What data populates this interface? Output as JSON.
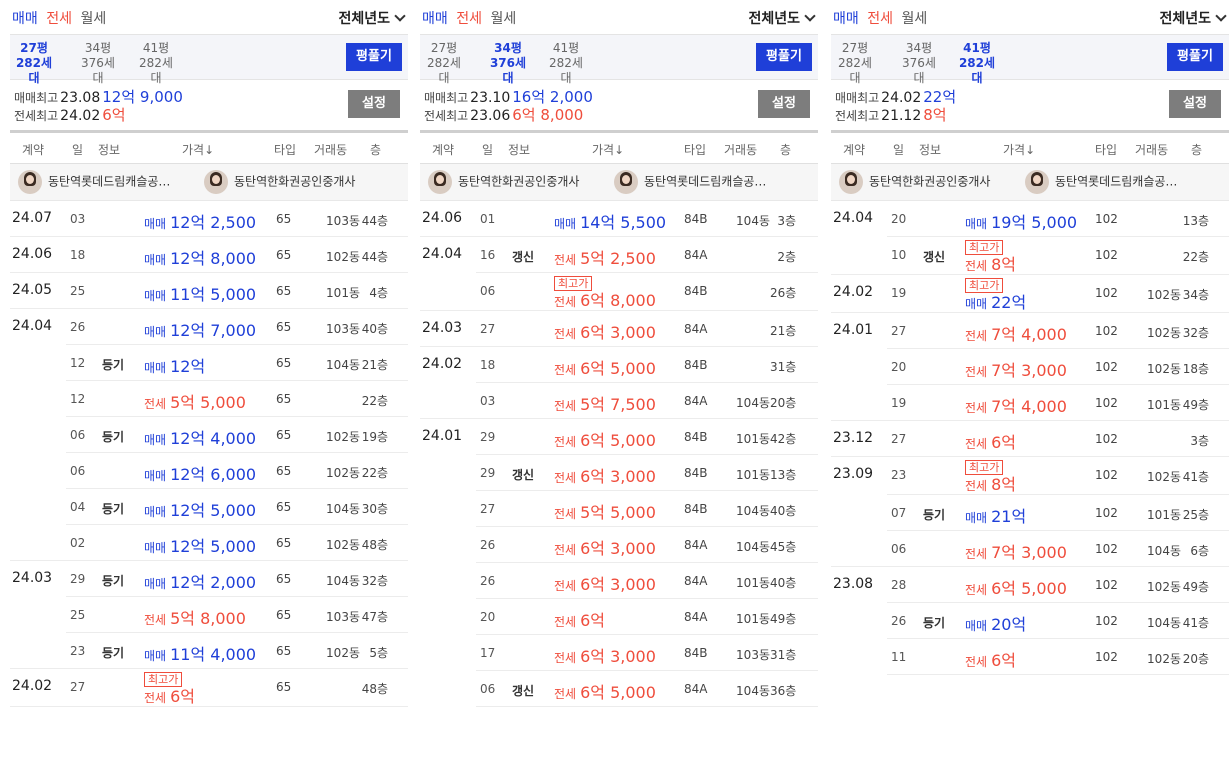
{
  "panels": [
    {
      "tabs": {
        "sale": "매매",
        "jeonse": "전세",
        "rent": "월세"
      },
      "year_filter": "전체년도",
      "sizes": [
        {
          "pyeong": "27평",
          "households": "282세대"
        },
        {
          "pyeong": "34평",
          "households": "376세대"
        },
        {
          "pyeong": "41평",
          "households": "282세대"
        }
      ],
      "pyeong_button": "평풀기",
      "max_sale": {
        "label": "매매최고",
        "date": "23.08",
        "price": "12억 9,000"
      },
      "max_jeonse": {
        "label": "전세최고",
        "date": "24.02",
        "price": "6억"
      },
      "settings_button": "설정",
      "headers": {
        "contract": "계약",
        "day": "일",
        "info": "정보",
        "price": "가격↓",
        "type": "타입",
        "dong": "거래동",
        "floor": "층"
      },
      "agents": [
        "동탄역롯데드림캐슬공…",
        "동탄역한화권공인중개사"
      ],
      "rows": [
        {
          "ym": "24.07",
          "day": "03",
          "info": "",
          "badge": "",
          "kind": "매매",
          "price": "12억 2,500",
          "type": "65",
          "dong": "103동",
          "floor": "44층"
        },
        {
          "ym": "24.06",
          "day": "18",
          "info": "",
          "badge": "",
          "kind": "매매",
          "price": "12억 8,000",
          "type": "65",
          "dong": "102동",
          "floor": "44층"
        },
        {
          "ym": "24.05",
          "day": "25",
          "info": "",
          "badge": "",
          "kind": "매매",
          "price": "11억 5,000",
          "type": "65",
          "dong": "101동",
          "floor": "4층"
        },
        {
          "ym": "24.04",
          "day": "26",
          "info": "",
          "badge": "",
          "kind": "매매",
          "price": "12억 7,000",
          "type": "65",
          "dong": "103동",
          "floor": "40층"
        },
        {
          "ym": "",
          "day": "12",
          "info": "등기",
          "badge": "",
          "kind": "매매",
          "price": "12억",
          "type": "65",
          "dong": "104동",
          "floor": "21층"
        },
        {
          "ym": "",
          "day": "12",
          "info": "",
          "badge": "",
          "kind": "전세",
          "price": "5억 5,000",
          "type": "65",
          "dong": "",
          "floor": "22층"
        },
        {
          "ym": "",
          "day": "06",
          "info": "등기",
          "badge": "",
          "kind": "매매",
          "price": "12억 4,000",
          "type": "65",
          "dong": "102동",
          "floor": "19층"
        },
        {
          "ym": "",
          "day": "06",
          "info": "",
          "badge": "",
          "kind": "매매",
          "price": "12억 6,000",
          "type": "65",
          "dong": "102동",
          "floor": "22층"
        },
        {
          "ym": "",
          "day": "04",
          "info": "등기",
          "badge": "",
          "kind": "매매",
          "price": "12억 5,000",
          "type": "65",
          "dong": "104동",
          "floor": "30층"
        },
        {
          "ym": "",
          "day": "02",
          "info": "",
          "badge": "",
          "kind": "매매",
          "price": "12억 5,000",
          "type": "65",
          "dong": "102동",
          "floor": "48층"
        },
        {
          "ym": "24.03",
          "day": "29",
          "info": "등기",
          "badge": "",
          "kind": "매매",
          "price": "12억 2,000",
          "type": "65",
          "dong": "104동",
          "floor": "32층"
        },
        {
          "ym": "",
          "day": "25",
          "info": "",
          "badge": "",
          "kind": "전세",
          "price": "5억 8,000",
          "type": "65",
          "dong": "103동",
          "floor": "47층"
        },
        {
          "ym": "",
          "day": "23",
          "info": "등기",
          "badge": "",
          "kind": "매매",
          "price": "11억 4,000",
          "type": "65",
          "dong": "102동",
          "floor": "5층"
        },
        {
          "ym": "24.02",
          "day": "27",
          "info": "",
          "badge": "최고가",
          "kind": "전세",
          "price": "6억",
          "type": "65",
          "dong": "",
          "floor": "48층"
        }
      ]
    },
    {
      "tabs": {
        "sale": "매매",
        "jeonse": "전세",
        "rent": "월세"
      },
      "year_filter": "전체년도",
      "sizes": [
        {
          "pyeong": "27평",
          "households": "282세대"
        },
        {
          "pyeong": "34평",
          "households": "376세대"
        },
        {
          "pyeong": "41평",
          "households": "282세대"
        }
      ],
      "pyeong_button": "평풀기",
      "max_sale": {
        "label": "매매최고",
        "date": "23.10",
        "price": "16억 2,000"
      },
      "max_jeonse": {
        "label": "전세최고",
        "date": "23.06",
        "price": "6억 8,000"
      },
      "settings_button": "설정",
      "headers": {
        "contract": "계약",
        "day": "일",
        "info": "정보",
        "price": "가격↓",
        "type": "타입",
        "dong": "거래동",
        "floor": "층"
      },
      "agents": [
        "동탄역한화권공인중개사",
        "동탄역롯데드림캐슬공…"
      ],
      "rows": [
        {
          "ym": "24.06",
          "day": "01",
          "info": "",
          "badge": "",
          "kind": "매매",
          "price": "14억 5,500",
          "type": "84B",
          "dong": "104동",
          "floor": "3층"
        },
        {
          "ym": "24.04",
          "day": "16",
          "info": "갱신",
          "badge": "",
          "kind": "전세",
          "price": "5억 2,500",
          "type": "84A",
          "dong": "",
          "floor": "2층"
        },
        {
          "ym": "",
          "day": "06",
          "info": "",
          "badge": "최고가",
          "kind": "전세",
          "price": "6억 8,000",
          "type": "84B",
          "dong": "",
          "floor": "26층"
        },
        {
          "ym": "24.03",
          "day": "27",
          "info": "",
          "badge": "",
          "kind": "전세",
          "price": "6억 3,000",
          "type": "84A",
          "dong": "",
          "floor": "21층"
        },
        {
          "ym": "24.02",
          "day": "18",
          "info": "",
          "badge": "",
          "kind": "전세",
          "price": "6억 5,000",
          "type": "84B",
          "dong": "",
          "floor": "31층"
        },
        {
          "ym": "",
          "day": "03",
          "info": "",
          "badge": "",
          "kind": "전세",
          "price": "5억 7,500",
          "type": "84A",
          "dong": "104동",
          "floor": "20층"
        },
        {
          "ym": "24.01",
          "day": "29",
          "info": "",
          "badge": "",
          "kind": "전세",
          "price": "6억 5,000",
          "type": "84B",
          "dong": "101동",
          "floor": "42층"
        },
        {
          "ym": "",
          "day": "29",
          "info": "갱신",
          "badge": "",
          "kind": "전세",
          "price": "6억 3,000",
          "type": "84B",
          "dong": "101동",
          "floor": "13층"
        },
        {
          "ym": "",
          "day": "27",
          "info": "",
          "badge": "",
          "kind": "전세",
          "price": "5억 5,000",
          "type": "84B",
          "dong": "104동",
          "floor": "40층"
        },
        {
          "ym": "",
          "day": "26",
          "info": "",
          "badge": "",
          "kind": "전세",
          "price": "6억 3,000",
          "type": "84A",
          "dong": "104동",
          "floor": "45층"
        },
        {
          "ym": "",
          "day": "26",
          "info": "",
          "badge": "",
          "kind": "전세",
          "price": "6억 3,000",
          "type": "84A",
          "dong": "101동",
          "floor": "40층"
        },
        {
          "ym": "",
          "day": "20",
          "info": "",
          "badge": "",
          "kind": "전세",
          "price": "6억",
          "type": "84A",
          "dong": "101동",
          "floor": "49층"
        },
        {
          "ym": "",
          "day": "17",
          "info": "",
          "badge": "",
          "kind": "전세",
          "price": "6억 3,000",
          "type": "84B",
          "dong": "103동",
          "floor": "31층"
        },
        {
          "ym": "",
          "day": "06",
          "info": "갱신",
          "badge": "",
          "kind": "전세",
          "price": "6억 5,000",
          "type": "84A",
          "dong": "104동",
          "floor": "36층"
        }
      ]
    },
    {
      "tabs": {
        "sale": "매매",
        "jeonse": "전세",
        "rent": "월세"
      },
      "year_filter": "전체년도",
      "sizes": [
        {
          "pyeong": "27평",
          "households": "282세대"
        },
        {
          "pyeong": "34평",
          "households": "376세대"
        },
        {
          "pyeong": "41평",
          "households": "282세대"
        }
      ],
      "pyeong_button": "평풀기",
      "max_sale": {
        "label": "매매최고",
        "date": "24.02",
        "price": "22억"
      },
      "max_jeonse": {
        "label": "전세최고",
        "date": "21.12",
        "price": "8억"
      },
      "settings_button": "설정",
      "headers": {
        "contract": "계약",
        "day": "일",
        "info": "정보",
        "price": "가격↓",
        "type": "타입",
        "dong": "거래동",
        "floor": "층"
      },
      "agents": [
        "동탄역한화권공인중개사",
        "동탄역롯데드림캐슬공…"
      ],
      "rows": [
        {
          "ym": "24.04",
          "day": "20",
          "info": "",
          "badge": "",
          "kind": "매매",
          "price": "19억 5,000",
          "type": "102",
          "dong": "",
          "floor": "13층"
        },
        {
          "ym": "",
          "day": "10",
          "info": "갱신",
          "badge": "최고가",
          "kind": "전세",
          "price": "8억",
          "type": "102",
          "dong": "",
          "floor": "22층"
        },
        {
          "ym": "24.02",
          "day": "19",
          "info": "",
          "badge": "최고가",
          "kind": "매매",
          "price": "22억",
          "type": "102",
          "dong": "102동",
          "floor": "34층"
        },
        {
          "ym": "24.01",
          "day": "27",
          "info": "",
          "badge": "",
          "kind": "전세",
          "price": "7억 4,000",
          "type": "102",
          "dong": "102동",
          "floor": "32층"
        },
        {
          "ym": "",
          "day": "20",
          "info": "",
          "badge": "",
          "kind": "전세",
          "price": "7억 3,000",
          "type": "102",
          "dong": "102동",
          "floor": "18층"
        },
        {
          "ym": "",
          "day": "19",
          "info": "",
          "badge": "",
          "kind": "전세",
          "price": "7억 4,000",
          "type": "102",
          "dong": "101동",
          "floor": "49층"
        },
        {
          "ym": "23.12",
          "day": "27",
          "info": "",
          "badge": "",
          "kind": "전세",
          "price": "6억",
          "type": "102",
          "dong": "",
          "floor": "3층"
        },
        {
          "ym": "23.09",
          "day": "23",
          "info": "",
          "badge": "최고가",
          "kind": "전세",
          "price": "8억",
          "type": "102",
          "dong": "102동",
          "floor": "41층"
        },
        {
          "ym": "",
          "day": "07",
          "info": "등기",
          "badge": "",
          "kind": "매매",
          "price": "21억",
          "type": "102",
          "dong": "101동",
          "floor": "25층"
        },
        {
          "ym": "",
          "day": "06",
          "info": "",
          "badge": "",
          "kind": "전세",
          "price": "7억 3,000",
          "type": "102",
          "dong": "104동",
          "floor": "6층"
        },
        {
          "ym": "23.08",
          "day": "28",
          "info": "",
          "badge": "",
          "kind": "전세",
          "price": "6억 5,000",
          "type": "102",
          "dong": "102동",
          "floor": "49층"
        },
        {
          "ym": "",
          "day": "26",
          "info": "등기",
          "badge": "",
          "kind": "매매",
          "price": "20억",
          "type": "102",
          "dong": "104동",
          "floor": "41층"
        },
        {
          "ym": "",
          "day": "11",
          "info": "",
          "badge": "",
          "kind": "전세",
          "price": "6억",
          "type": "102",
          "dong": "102동",
          "floor": "20층"
        }
      ]
    }
  ],
  "selected_size": [
    0,
    1,
    2
  ],
  "colors": {
    "sale": "#1f3fd8",
    "jeonse": "#ef4d3c",
    "button": "#1f3fd8",
    "settings": "#7d7d7d"
  }
}
